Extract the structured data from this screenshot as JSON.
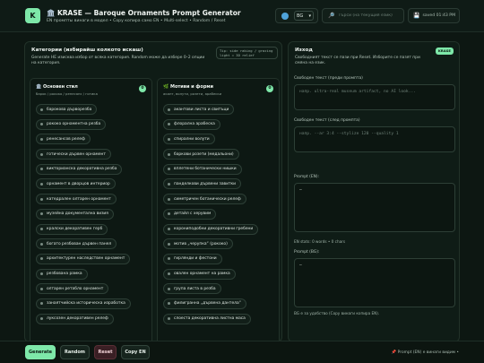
{
  "header": {
    "logo_letter": "K",
    "title": "🏛️ KRASE — Baroque Ornaments Prompt Generator",
    "subtitle": "EN промпты винаги в модел • Copy копира само EN • Multi-select • Random / Reset",
    "language": "BG",
    "search_placeholder": "Търси (на текущия език)",
    "saved": "saved 01:43 PM"
  },
  "left_panel": {
    "title": "Категории (избирайш колкото искаш)",
    "description": "Generate НЕ изисква избор от всяка категория. Random може да избере 0–2 опции на категория.",
    "tip": "Tip: side raking / grazing light = 3D relief",
    "columns": [
      {
        "title": "🏛️ Основен стил",
        "subtitle": "барок / рококо / ренесанс / готика",
        "count": "0",
        "options": [
          "барокова дърворезба",
          "рококо орнаментна резба",
          "ренесансов релеф",
          "готически дървен орнамент",
          "викторианска декоративна резба",
          "орнамент в дворцов интериор",
          "катедрален олтарен орнамент",
          "музейна документална визия",
          "кралски декоративен герб",
          "богато резбован дървен панел",
          "архитектурен наследствен орнамент",
          "резбована рамка",
          "олтарен ретабло орнамент",
          "занаятчийска историческа изработка",
          "луксозен декоративен релеф"
        ]
      },
      {
        "title": "🌿 Мотиви и форми",
        "subtitle": "акант, волути, розети, арабески",
        "count": "0",
        "options": [
          "акантови листа и свитъци",
          "флорална арабеска",
          "спирални волути",
          "баркови розети (медальони)",
          "вплетени ботанически нишки",
          "панделкови дървени завитки",
          "симетричен ботанически релеф",
          "детайл с херувим",
          "корониподобни декоративни гребени",
          "мотив „черупка“ (рококо)",
          "гирлянди и фестони",
          "овален орнамент на рамка",
          "група листа в резба",
          "филигранна „дървена дантела“",
          "слоеста декоративна листна маса"
        ]
      }
    ]
  },
  "right_panel": {
    "title": "Изход",
    "badge": "KRASE",
    "description": "Свободният текст се пази при Reset. Изборите се пазят при смяна на език.",
    "free_before_label": "Свободен текст (преди промпта)",
    "free_before_placeholder": "напр. ultra-real museum artifact, no AI look...",
    "free_after_label": "Свободен текст (след промпта)",
    "free_after_placeholder": "напр. --ar 3:4 --stylize 120 --quality 1",
    "prompt_en_label": "Prompt (EN):",
    "prompt_en_value": "–",
    "en_stats": "EN stats: 0 words • 0 chars",
    "prompt_bg_label": "Prompt (BG):",
    "prompt_bg_value": "–",
    "bg_note": "BG е за удобство (Copy винаги копира EN)."
  },
  "footer": {
    "generate": "Generate",
    "random": "Random",
    "reset": "Reset",
    "copy": "Copy EN",
    "note": "📌 Prompt (EN) е винаги видим •"
  },
  "colors": {
    "accent": "#7ee8a9",
    "background": "#0d1712",
    "reset": "#3a1f24"
  }
}
